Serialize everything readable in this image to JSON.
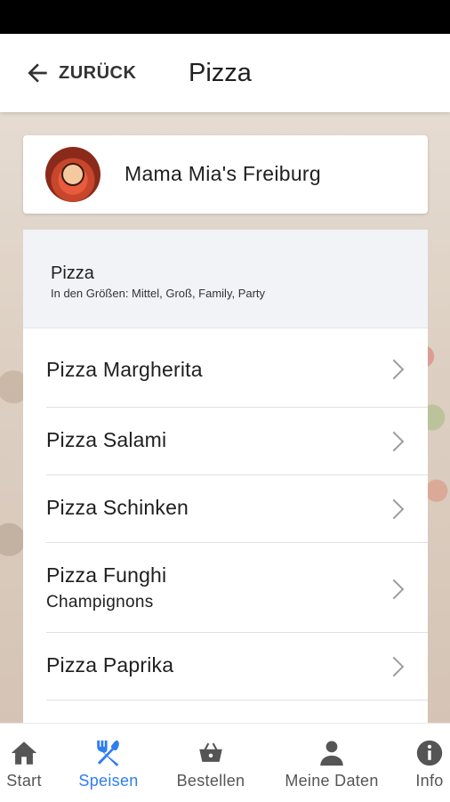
{
  "header": {
    "back_label": "ZURÜCK",
    "title": "Pizza"
  },
  "restaurant": {
    "name": "Mama Mia's Freiburg"
  },
  "category": {
    "title": "Pizza",
    "subtitle": "In den Größen: Mittel, Groß, Family, Party"
  },
  "items": [
    {
      "label": "Pizza Margherita",
      "sub": ""
    },
    {
      "label": "Pizza Salami",
      "sub": ""
    },
    {
      "label": "Pizza Schinken",
      "sub": ""
    },
    {
      "label": "Pizza Funghi",
      "sub": "Champignons"
    },
    {
      "label": "Pizza Paprika",
      "sub": ""
    }
  ],
  "tabs": [
    {
      "label": "Start",
      "icon": "home-icon",
      "active": false
    },
    {
      "label": "Speisen",
      "icon": "cutlery-icon",
      "active": true
    },
    {
      "label": "Bestellen",
      "icon": "basket-icon",
      "active": false
    },
    {
      "label": "Meine Daten",
      "icon": "person-icon",
      "active": false
    },
    {
      "label": "Info",
      "icon": "info-icon",
      "active": false
    }
  ],
  "colors": {
    "accent": "#2f7df0",
    "icon_gray": "#555555",
    "category_bg": "#f1f3f6"
  }
}
